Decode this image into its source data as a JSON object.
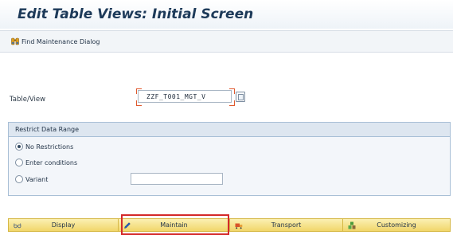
{
  "window": {
    "title": "Edit Table Views: Initial Screen"
  },
  "toolbar": {
    "find_label": "Find Maintenance Dialog",
    "find_icon": "binoculars-icon"
  },
  "form": {
    "table_view_label": "Table/View",
    "table_view_value": "ZZF_T001_MGT_V"
  },
  "restrict": {
    "title": "Restrict Data Range",
    "options": [
      {
        "label": "No Restrictions",
        "selected": true
      },
      {
        "label": "Enter conditions",
        "selected": false
      },
      {
        "label": "Variant",
        "selected": false
      }
    ],
    "variant_value": ""
  },
  "actions": {
    "display_label": "Display",
    "maintain_label": "Maintain",
    "transport_label": "Transport",
    "customizing_label": "Customizing"
  },
  "colors": {
    "title": "#1d3a59",
    "button_bg": "#f1d66a",
    "highlight": "#d42a2a",
    "required_marker": "#e0592e"
  }
}
